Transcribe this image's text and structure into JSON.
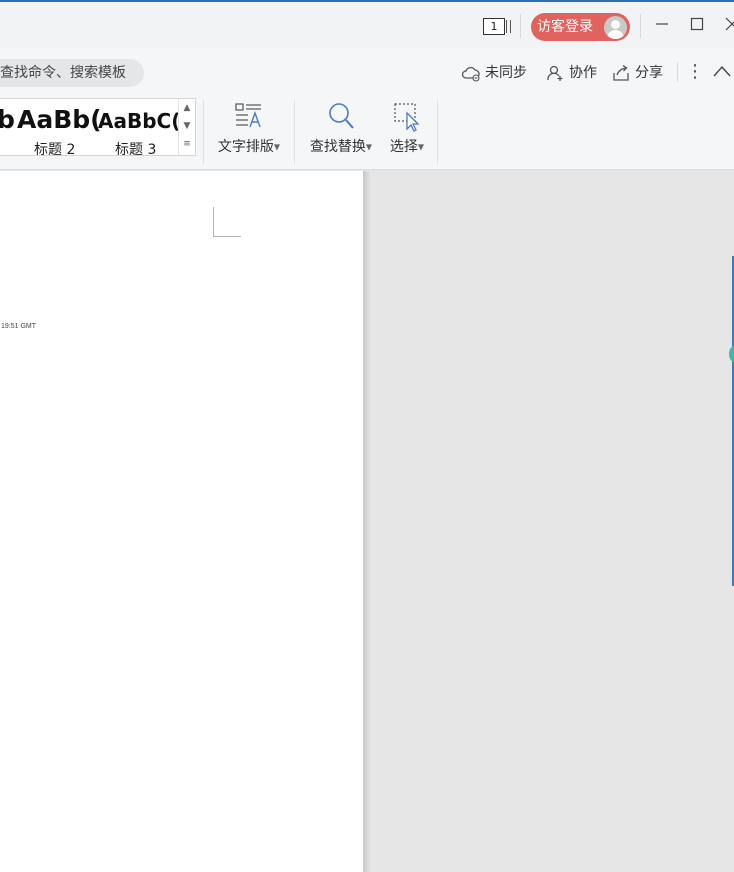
{
  "titlebar": {
    "tab_count": "1",
    "login_label": "访客登录",
    "minimize": "—",
    "close": "✕"
  },
  "search": {
    "placeholder": "查找命令、搜索模板"
  },
  "top_actions": {
    "sync": "未同步",
    "collaborate": "协作",
    "share": "分享",
    "more": "⋮"
  },
  "styles": {
    "previews": [
      "b",
      "AaBb(",
      "AaBbC("
    ],
    "labels": [
      "标题 2",
      "标题 3"
    ]
  },
  "ribbon_buttons": {
    "text_layout": "文字排版",
    "find_replace": "查找替换",
    "select": "选择"
  },
  "document": {
    "fragment": "19:51 GMT"
  },
  "colors": {
    "accent": "#2f6db5",
    "login_bg": "#e0635e",
    "workspace": "#e6e6e6"
  }
}
